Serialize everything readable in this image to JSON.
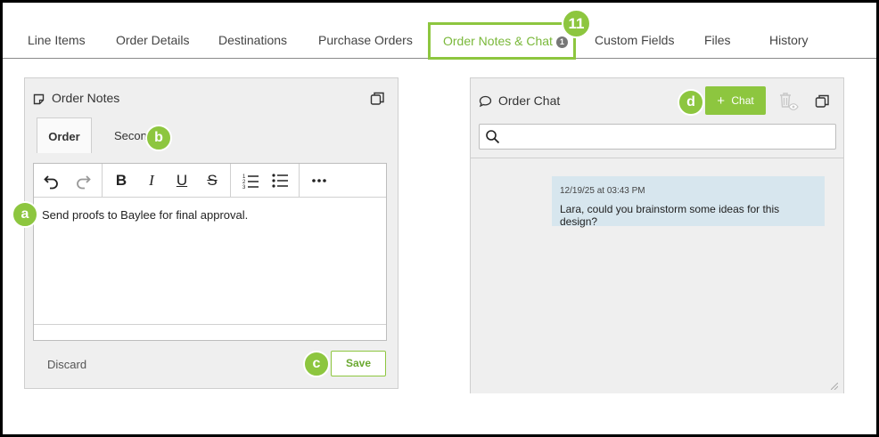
{
  "tabs": [
    {
      "label": "Line Items"
    },
    {
      "label": "Order Details"
    },
    {
      "label": "Destinations"
    },
    {
      "label": "Purchase Orders"
    },
    {
      "label": "Order Notes & Chat",
      "badge": "1"
    },
    {
      "label": "Custom Fields"
    },
    {
      "label": "Files"
    },
    {
      "label": "History"
    }
  ],
  "callouts": {
    "tab": "11",
    "a": "a",
    "b": "b",
    "c": "c",
    "d": "d"
  },
  "notes": {
    "title": "Order Notes",
    "tabs": [
      {
        "label": "Order"
      },
      {
        "label": "Second"
      }
    ],
    "content": "Send proofs to Baylee for final approval.",
    "discard_label": "Discard",
    "save_label": "Save"
  },
  "chat": {
    "title": "Order Chat",
    "add_label": "Chat",
    "search_placeholder": "",
    "messages": [
      {
        "timestamp": "12/19/25 at 03:43 PM",
        "text": "Lara, could you brainstorm some ideas for this design?"
      }
    ]
  },
  "colors": {
    "accent": "#8dc63f",
    "message_bg": "#d7e6ee"
  }
}
